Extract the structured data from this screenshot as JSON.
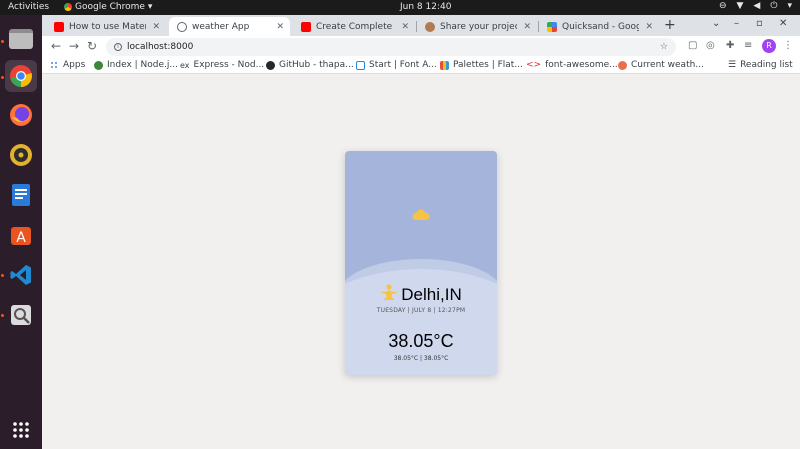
{
  "topbar": {
    "activities": "Activities",
    "app_name": "Google Chrome",
    "clock": "Jun 8  12:40"
  },
  "dock": {
    "apps": [
      "files",
      "chrome",
      "firefox",
      "rhythmbox",
      "libreoffice-writer",
      "ubuntu-software",
      "vscode",
      "image-viewer"
    ],
    "show_apps_icon": "grid-icon"
  },
  "browser": {
    "tabs": [
      {
        "title": "How to use Material U",
        "favicon": "youtube-icon"
      },
      {
        "title": "weather App",
        "favicon": "globe-icon"
      },
      {
        "title": "Create Complete W",
        "favicon": "youtube-icon"
      },
      {
        "title": "Share your project|ui",
        "favicon": "avatar-icon"
      },
      {
        "title": "Quicksand - Google F",
        "favicon": "google-fonts-icon"
      }
    ],
    "url": "localhost:8000",
    "profile_initial": "R",
    "bookmarks": {
      "apps": "Apps",
      "items": [
        "Index | Node.j...",
        "Express - Nod...",
        "GitHub - thapa...",
        "Start | Font A...",
        "Palettes | Flat...",
        "font-awesome...",
        "Current weath..."
      ],
      "reading_list": "Reading list"
    }
  },
  "weather": {
    "icon": "cloud-sun-icon",
    "location_icon": "person-icon",
    "city": "Delhi,IN",
    "date": "TUESDAY | JULY 8 | 12:27PM",
    "temperature": "38.05°C",
    "min_max": "38.05°C | 38.05°C"
  },
  "colors": {
    "card_top": "#a5b4da",
    "card_bottom": "#d0d8ee",
    "sun": "#f6c344",
    "page_bg": "#f1f0ee"
  }
}
